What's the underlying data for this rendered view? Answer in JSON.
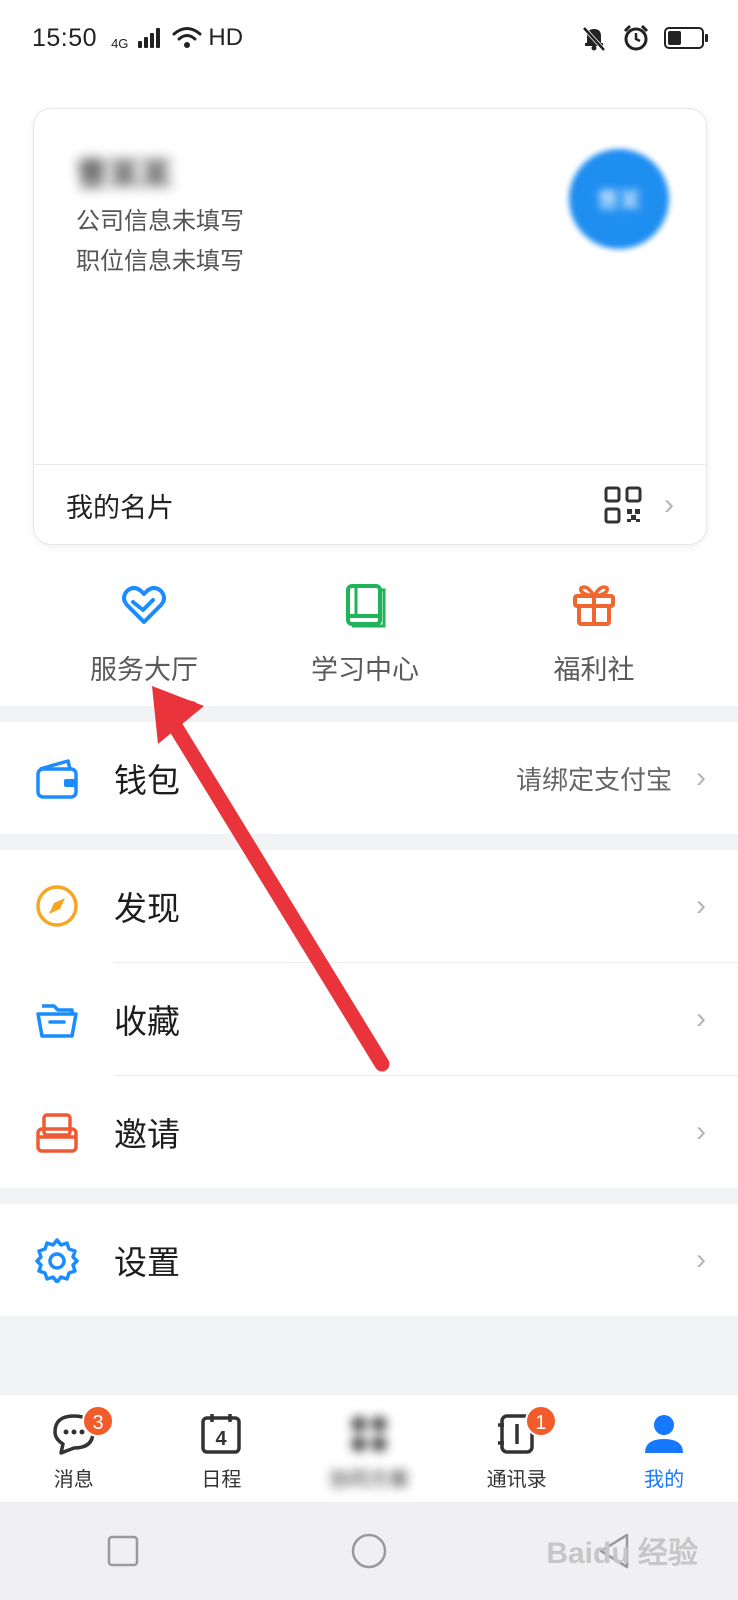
{
  "status_bar": {
    "time": "15:50",
    "network": "4G",
    "hd": "HD"
  },
  "profile": {
    "name": "曹某某",
    "company": "公司信息未填写",
    "position": "职位信息未填写",
    "avatar_text": "曹某",
    "card_label": "我的名片"
  },
  "quick_actions": [
    {
      "label": "服务大厅",
      "icon": "heart-hands-icon",
      "color": "#1a8cff"
    },
    {
      "label": "学习中心",
      "icon": "book-icon",
      "color": "#20b35a"
    },
    {
      "label": "福利社",
      "icon": "gift-icon",
      "color": "#f0662e"
    }
  ],
  "menu": {
    "wallet": {
      "label": "钱包",
      "extra": "请绑定支付宝"
    },
    "discover": {
      "label": "发现"
    },
    "favorites": {
      "label": "收藏"
    },
    "invite": {
      "label": "邀请"
    },
    "settings": {
      "label": "设置"
    }
  },
  "tabs": [
    {
      "label": "消息",
      "badge": "3",
      "icon": "chat-icon"
    },
    {
      "label": "日程",
      "icon": "calendar-icon",
      "calendar_day": "4"
    },
    {
      "label": "协同方案",
      "icon": "apps-icon"
    },
    {
      "label": "通讯录",
      "badge": "1",
      "icon": "contacts-icon"
    },
    {
      "label": "我的",
      "icon": "person-icon",
      "active": true
    }
  ],
  "watermark": "Baidu 经验",
  "colors": {
    "accent": "#1677ff",
    "badge": "#f25b2a",
    "annotation_arrow": "#e8343a"
  }
}
